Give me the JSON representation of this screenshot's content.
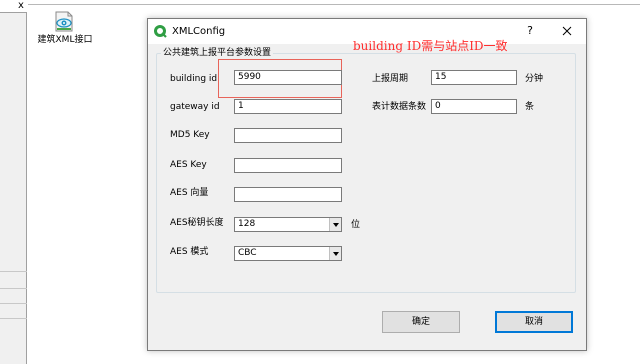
{
  "desktop": {
    "left_pane_close": "x",
    "icon_label": "建筑XML接口",
    "icon_name": "eye-document-icon"
  },
  "dialog": {
    "title": "XMLConfig",
    "help_label": "?",
    "close_icon": "close-icon",
    "annotation": "building ID需与站点ID一致",
    "annotation_color": "#ff2d2d",
    "group_title": "公共建筑上报平台参数设置",
    "fields": {
      "building_id": {
        "label": "building id",
        "value": "5990"
      },
      "gateway_id": {
        "label": "gateway id",
        "value": "1"
      },
      "md5_key": {
        "label": "MD5 Key",
        "value": ""
      },
      "aes_key": {
        "label": "AES Key",
        "value": ""
      },
      "aes_vector": {
        "label": "AES 向量",
        "value": ""
      },
      "aes_key_length": {
        "label": "AES秘钥长度",
        "value": "128",
        "unit": "位"
      },
      "aes_mode": {
        "label": "AES 模式",
        "value": "CBC"
      },
      "report_period": {
        "label": "上报周期",
        "value": "15",
        "unit": "分钟"
      },
      "table_records": {
        "label": "表计数据条数",
        "value": "0",
        "unit": "条"
      }
    },
    "ok_label": "确定",
    "cancel_label": "取消",
    "accent": "#0078d7"
  }
}
